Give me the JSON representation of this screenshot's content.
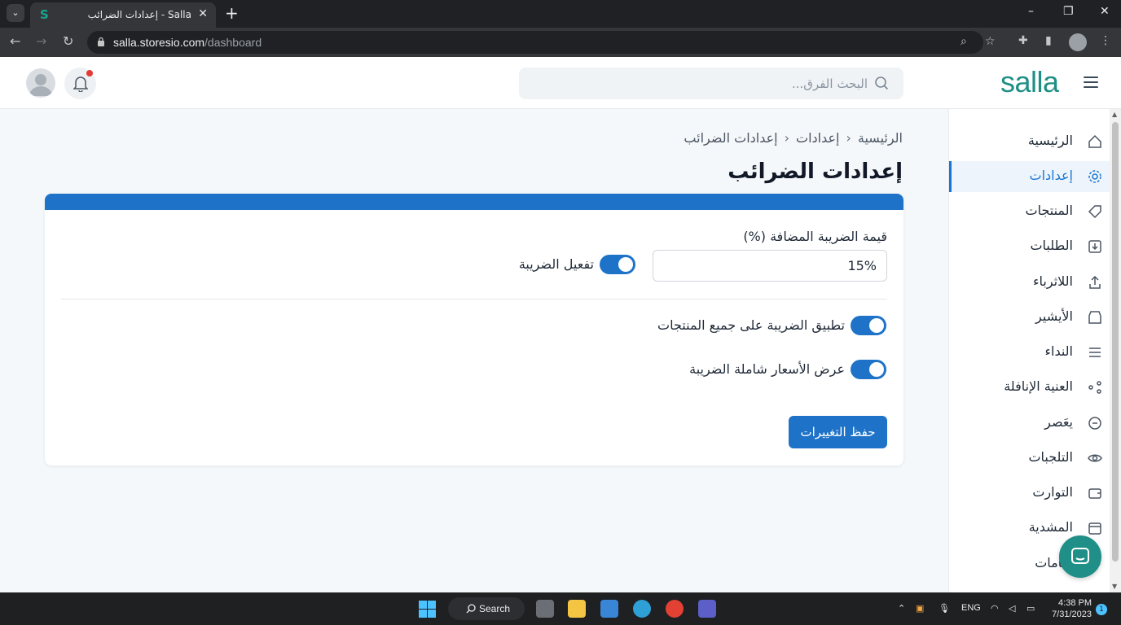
{
  "browser": {
    "tab_title": "Salla - إعدادات الضرائب",
    "url_host": "salla.storesio.com",
    "url_path": "/dashboard"
  },
  "header": {
    "logo": "salla",
    "search_placeholder": "البحث الفرق..."
  },
  "sidebar": {
    "items": [
      {
        "label": "الرئيسية",
        "icon": "home-icon"
      },
      {
        "label": "إعدادات",
        "icon": "gear-icon",
        "active": true
      },
      {
        "label": "المنتجات",
        "icon": "tag-icon"
      },
      {
        "label": "الطلبات",
        "icon": "download-box-icon"
      },
      {
        "label": "اللاثرباء",
        "icon": "upload-icon"
      },
      {
        "label": "الأيشير",
        "icon": "store-icon"
      },
      {
        "label": "النداء",
        "icon": "list-icon"
      },
      {
        "label": "العنية الإنافلة",
        "icon": "share-icon"
      },
      {
        "label": "يعَصر",
        "icon": "badge-icon"
      },
      {
        "label": "التلجبات",
        "icon": "eye-icon"
      },
      {
        "label": "التوارت",
        "icon": "wallet-icon"
      },
      {
        "label": "المشدية",
        "icon": "calendar-icon"
      },
      {
        "label": "شامات",
        "icon": "more-icon"
      }
    ]
  },
  "main": {
    "breadcrumb": [
      "الرئيسية",
      "إعدادات",
      "إعدادات الضرائب"
    ],
    "title": "إعدادات الضرائب",
    "tax_value_label": "قيمة الضريبة المضافة (%)",
    "tax_value": "15%",
    "toggle_enable_label": "تفعيل الضريبة",
    "toggle_apply_all_label": "تطبيق الضريبة على جميع المنتجات",
    "toggle_show_inclusive_label": "عرض الأسعار شاملة الضريبة",
    "save_label": "حفظ التغييرات",
    "toggles_on": [
      true,
      true,
      true
    ]
  },
  "taskbar": {
    "search_label": "Search",
    "lang": "ENG",
    "time": "4:38 PM",
    "date": "7/31/2023",
    "notif_count": "1"
  },
  "colors": {
    "brand": "#1e8f86",
    "accent": "#1e73c8"
  }
}
